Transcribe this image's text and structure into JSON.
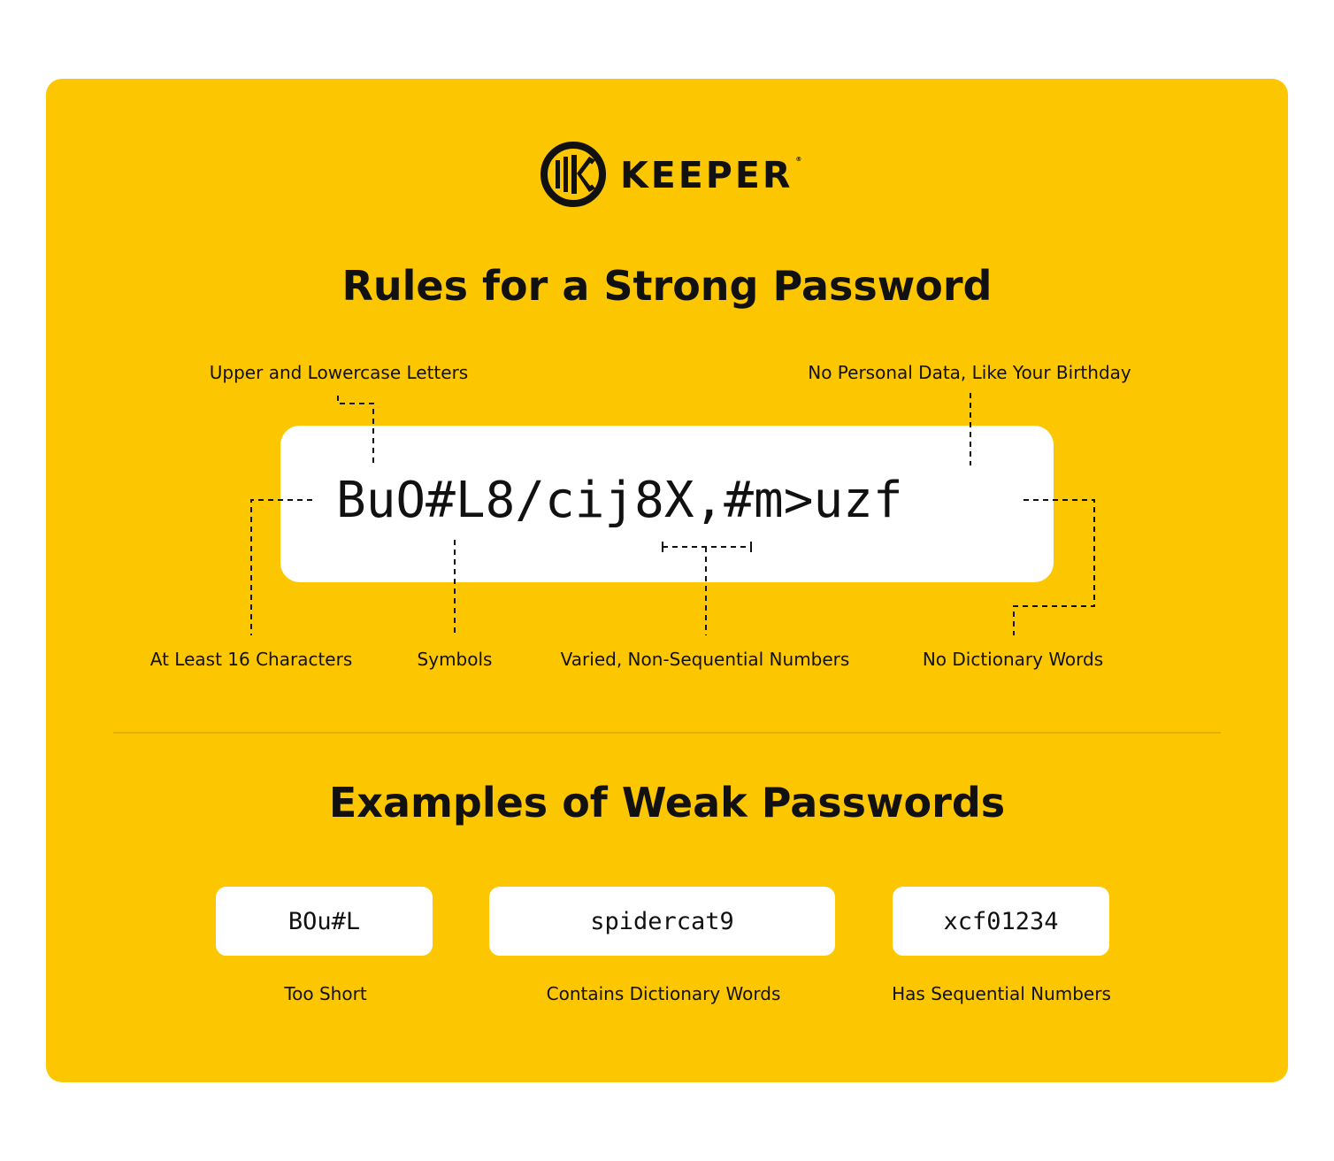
{
  "brand": {
    "name": "KEEPER",
    "registered": "®"
  },
  "headings": {
    "rules": "Rules for a Strong Password",
    "weak": "Examples of Weak Passwords"
  },
  "example_password": "BuO#L8/cij8X,#m>uzf",
  "rule_labels": {
    "upper_lower": "Upper and Lowercase Letters",
    "no_personal": "No Personal Data, Like Your Birthday",
    "length": "At Least 16 Characters",
    "symbols": "Symbols",
    "numbers": "Varied, Non-Sequential Numbers",
    "no_dictionary": "No Dictionary Words"
  },
  "weak_examples": [
    {
      "password": "BOu#L",
      "reason": "Too Short"
    },
    {
      "password": "spidercat9",
      "reason": "Contains Dictionary Words"
    },
    {
      "password": "xcf01234",
      "reason": "Has Sequential Numbers"
    }
  ],
  "colors": {
    "background": "#FCC600",
    "panel": "#FFFFFF",
    "text": "#111111"
  },
  "icons": {
    "logo": "keeper-logo-icon"
  }
}
